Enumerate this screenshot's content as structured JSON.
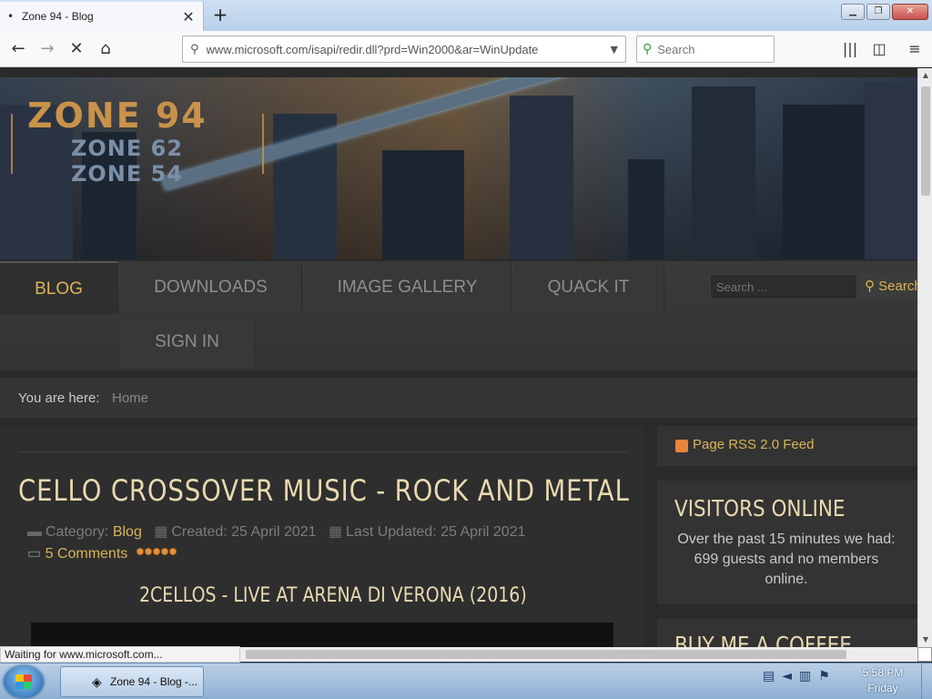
{
  "browser": {
    "tab_title": "Zone 94 - Blog",
    "url": "www.microsoft.com/isapi/redir.dll?prd=Win2000&ar=WinUpdate",
    "search_placeholder": "Search",
    "status_text": "Waiting for www.microsoft.com..."
  },
  "site": {
    "logo_main": "ZONE 94",
    "logo_sub1": "ZONE 62",
    "logo_sub2": "ZONE 54",
    "menu": [
      "BLOG",
      "DOWNLOADS",
      "IMAGE GALLERY",
      "QUACK IT",
      "SIGN IN"
    ],
    "search_placeholder": "Search ...",
    "search_button": "Search",
    "breadcrumb_label": "You are here:",
    "breadcrumb_home": "Home"
  },
  "article": {
    "title": "CELLO CROSSOVER MUSIC - ROCK AND METAL",
    "category_label": "Category:",
    "category": "Blog",
    "created": "Created: 25 April 2021",
    "updated": "Last Updated: 25 April 2021",
    "comments": "5 Comments",
    "rating_stars": 5,
    "subtitle": "2CELLOS - LIVE AT ARENA DI VERONA (2016)"
  },
  "sidebar": {
    "rss": "Page RSS 2.0 Feed",
    "visitors_title": "VISITORS ONLINE",
    "visitors_text": "Over the past 15 minutes we had: 699 guests and no members online.",
    "coffee_title": "BUY ME A COFFEE"
  },
  "taskbar": {
    "task_label": "Zone 94 - Blog -...",
    "time": "5:58 PM",
    "day": "Friday"
  },
  "colors": {
    "accent_gold": "#d9b453",
    "title_cream": "#e8d9b0"
  }
}
